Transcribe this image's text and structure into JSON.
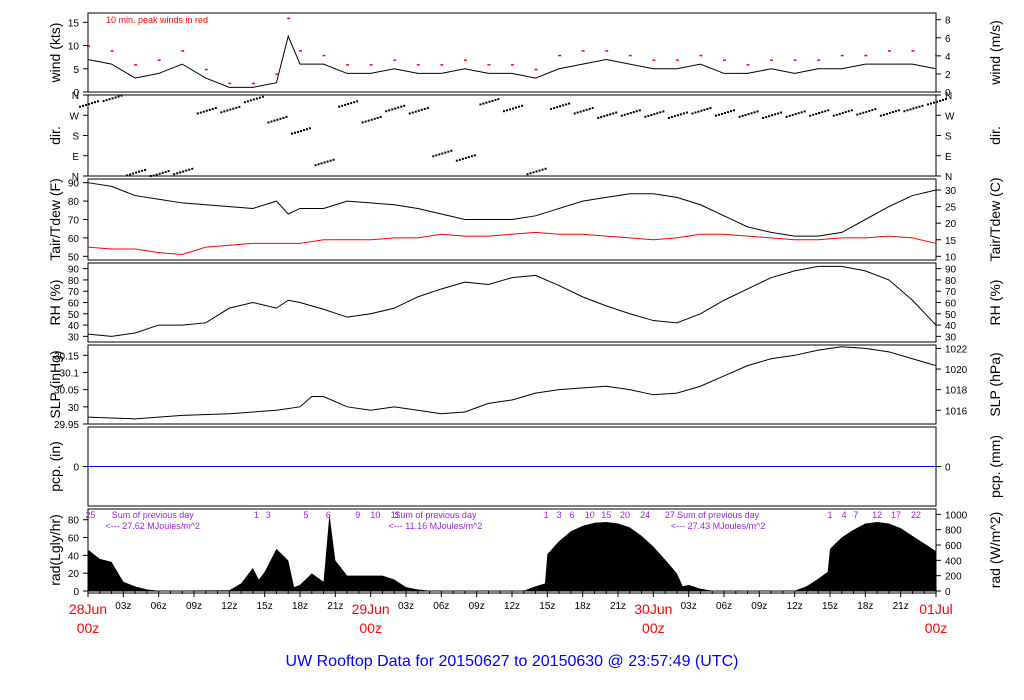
{
  "title": "UW Rooftop Data for 20150627  to  20150630 @ 23:57:49  (UTC)",
  "colors": {
    "red": "#ff0000",
    "blue": "#0000ff",
    "purple": "#a020f0",
    "black": "#000000"
  },
  "chart_data": [
    {
      "type": "line",
      "id": "wind",
      "ylabel": "wind (kts)",
      "ylabel_right": "wind (m/s)",
      "ylim": [
        0,
        17
      ],
      "yticks": [
        0,
        5,
        10,
        15
      ],
      "yticks_right": [
        {
          "v": 0,
          "label": "0"
        },
        {
          "v": 3.89,
          "label": "2"
        },
        {
          "v": 7.78,
          "label": "4"
        },
        {
          "v": 11.66,
          "label": "6"
        },
        {
          "v": 15.55,
          "label": "8"
        }
      ],
      "annotation": "10 min. peak winds in red",
      "hours": [
        0,
        2,
        4,
        6,
        8,
        10,
        12,
        14,
        16,
        17,
        18,
        20,
        22,
        24,
        26,
        28,
        30,
        32,
        34,
        36,
        38,
        40,
        42,
        44,
        46,
        48,
        50,
        52,
        54,
        56,
        58,
        60,
        62,
        64,
        66,
        68,
        70,
        72
      ],
      "series": [
        {
          "name": "wind",
          "values": [
            7,
            6,
            3,
            4,
            6,
            3,
            1,
            1,
            2,
            12,
            6,
            6,
            4,
            4,
            5,
            4,
            4,
            5,
            4,
            4,
            3,
            5,
            6,
            7,
            6,
            5,
            5,
            6,
            4,
            4,
            5,
            4,
            5,
            5,
            6,
            6,
            6,
            5
          ]
        },
        {
          "name": "peak",
          "values": [
            10,
            9,
            6,
            7,
            9,
            5,
            2,
            2,
            4,
            16,
            9,
            8,
            6,
            6,
            7,
            6,
            6,
            7,
            6,
            6,
            5,
            8,
            9,
            9,
            8,
            7,
            7,
            8,
            7,
            6,
            7,
            7,
            7,
            8,
            8,
            9,
            9,
            8
          ]
        }
      ]
    },
    {
      "type": "scatter",
      "id": "dir",
      "ylabel": "dir.",
      "ylabel_right": "dir.",
      "ylim": [
        0,
        360
      ],
      "yticks": [
        {
          "v": 0,
          "label": "N"
        },
        {
          "v": 90,
          "label": "E"
        },
        {
          "v": 180,
          "label": "S"
        },
        {
          "v": 270,
          "label": "W"
        },
        {
          "v": 360,
          "label": "N"
        }
      ],
      "hours": [
        0,
        2,
        4,
        6,
        8,
        10,
        12,
        14,
        16,
        18,
        20,
        22,
        24,
        26,
        28,
        30,
        32,
        34,
        36,
        38,
        40,
        42,
        44,
        46,
        48,
        50,
        52,
        54,
        56,
        58,
        60,
        62,
        64,
        66,
        68,
        70,
        72
      ],
      "values": [
        320,
        345,
        15,
        10,
        20,
        290,
        295,
        340,
        250,
        200,
        60,
        320,
        250,
        300,
        290,
        100,
        80,
        330,
        300,
        20,
        310,
        290,
        270,
        280,
        275,
        270,
        290,
        280,
        275,
        270,
        275,
        280,
        280,
        285,
        280,
        300,
        330
      ]
    },
    {
      "type": "line",
      "id": "temp",
      "ylabel": "Tair/Tdew (F)",
      "ylabel_right": "Tair/Tdew (C)",
      "ylim": [
        48,
        92
      ],
      "yticks": [
        50,
        60,
        70,
        80,
        90
      ],
      "yticks_right": [
        {
          "v": 50,
          "label": "10"
        },
        {
          "v": 59,
          "label": "15"
        },
        {
          "v": 68,
          "label": "20"
        },
        {
          "v": 77,
          "label": "25"
        },
        {
          "v": 86,
          "label": "30"
        }
      ],
      "hours": [
        0,
        2,
        4,
        6,
        8,
        10,
        12,
        14,
        16,
        17,
        18,
        20,
        22,
        24,
        26,
        28,
        30,
        32,
        34,
        36,
        38,
        40,
        42,
        44,
        46,
        48,
        50,
        52,
        54,
        56,
        58,
        60,
        62,
        64,
        66,
        68,
        70,
        72
      ],
      "series": [
        {
          "name": "Tair",
          "values": [
            90,
            88,
            83,
            81,
            79,
            78,
            77,
            76,
            80,
            73,
            76,
            76,
            80,
            79,
            78,
            76,
            73,
            70,
            70,
            70,
            72,
            76,
            80,
            82,
            84,
            84,
            82,
            78,
            72,
            66,
            63,
            61,
            61,
            63,
            70,
            77,
            83,
            86
          ]
        },
        {
          "name": "Tdew",
          "values": [
            55,
            54,
            54,
            52,
            51,
            55,
            56,
            57,
            57,
            57,
            57,
            59,
            59,
            59,
            60,
            60,
            62,
            61,
            61,
            62,
            63,
            62,
            62,
            61,
            60,
            59,
            60,
            62,
            62,
            61,
            60,
            59,
            59,
            60,
            60,
            61,
            60,
            57
          ]
        }
      ]
    },
    {
      "type": "line",
      "id": "rh",
      "ylabel": "RH (%)",
      "ylabel_right": "RH (%)",
      "ylim": [
        25,
        95
      ],
      "yticks": [
        30,
        40,
        50,
        60,
        70,
        80,
        90
      ],
      "hours": [
        0,
        2,
        4,
        6,
        8,
        10,
        12,
        14,
        16,
        17,
        18,
        20,
        22,
        24,
        26,
        28,
        30,
        32,
        34,
        36,
        38,
        40,
        42,
        44,
        46,
        48,
        50,
        52,
        54,
        56,
        58,
        60,
        62,
        64,
        66,
        68,
        70,
        72
      ],
      "values": [
        32,
        30,
        33,
        40,
        40,
        42,
        55,
        60,
        55,
        62,
        60,
        54,
        47,
        50,
        55,
        65,
        72,
        78,
        76,
        82,
        84,
        75,
        65,
        57,
        50,
        44,
        42,
        50,
        62,
        72,
        82,
        88,
        92,
        92,
        88,
        80,
        62,
        40
      ]
    },
    {
      "type": "line",
      "id": "slp",
      "ylabel": "SLP (inHg)",
      "ylabel_right": "SLP (hPa)",
      "ylim": [
        29.95,
        30.18
      ],
      "yticks": [
        29.95,
        30.0,
        30.05,
        30.1,
        30.15
      ],
      "yticks_right": [
        {
          "v": 29.99,
          "label": "1016"
        },
        {
          "v": 30.05,
          "label": "1018"
        },
        {
          "v": 30.11,
          "label": "1020"
        },
        {
          "v": 30.17,
          "label": "1022"
        }
      ],
      "hours": [
        0,
        4,
        8,
        12,
        16,
        18,
        19,
        20,
        22,
        24,
        26,
        28,
        30,
        32,
        34,
        36,
        38,
        40,
        42,
        44,
        46,
        48,
        50,
        52,
        54,
        56,
        58,
        60,
        62,
        64,
        66,
        68,
        70,
        72
      ],
      "values": [
        29.97,
        29.965,
        29.975,
        29.98,
        29.99,
        30.0,
        30.03,
        30.03,
        30.0,
        29.99,
        30.0,
        29.99,
        29.98,
        29.985,
        30.01,
        30.02,
        30.04,
        30.05,
        30.055,
        30.06,
        30.05,
        30.035,
        30.04,
        30.06,
        30.09,
        30.12,
        30.14,
        30.15,
        30.165,
        30.175,
        30.17,
        30.16,
        30.14,
        30.12
      ]
    },
    {
      "type": "line",
      "id": "pcp",
      "ylabel": "pcp. (in)",
      "ylabel_right": "pcp. (mm)",
      "ylim": [
        -1,
        1
      ],
      "yticks": [
        0
      ],
      "yticks_right": [
        {
          "v": 0,
          "label": "0"
        }
      ],
      "hours": [
        0,
        72
      ],
      "values": [
        0,
        0
      ]
    },
    {
      "type": "area",
      "id": "rad",
      "ylabel": "rad(Lgly/hr)",
      "ylabel_right": "rad (W/m^2)",
      "ylim": [
        0,
        1070
      ],
      "yticks": [
        {
          "v": 0,
          "label": "0"
        },
        {
          "v": 232.6,
          "label": "20"
        },
        {
          "v": 465.2,
          "label": "40"
        },
        {
          "v": 697.8,
          "label": "60"
        },
        {
          "v": 930.4,
          "label": "80"
        }
      ],
      "yticks_right": [
        {
          "v": 0,
          "label": "0"
        },
        {
          "v": 200,
          "label": "200"
        },
        {
          "v": 400,
          "label": "400"
        },
        {
          "v": 600,
          "label": "600"
        },
        {
          "v": 800,
          "label": "800"
        },
        {
          "v": 1000,
          "label": "1000"
        }
      ],
      "hours": [
        0,
        1,
        2,
        3,
        4,
        5,
        6,
        12,
        13,
        14,
        14.5,
        15,
        16,
        17,
        17.5,
        18,
        19,
        20,
        20.5,
        21,
        22,
        23,
        24,
        25,
        26,
        27,
        28,
        29,
        37,
        38,
        38.8,
        39,
        40,
        41,
        42,
        43,
        44,
        45,
        46,
        47,
        48,
        49,
        50,
        50.5,
        51,
        52,
        53,
        60,
        61,
        62,
        62.8,
        63,
        64,
        65,
        66,
        67,
        68,
        69,
        70,
        71,
        72
      ],
      "values": [
        540,
        420,
        380,
        120,
        60,
        20,
        5,
        10,
        100,
        300,
        150,
        250,
        550,
        400,
        50,
        80,
        230,
        120,
        1000,
        400,
        200,
        200,
        200,
        200,
        150,
        50,
        20,
        5,
        5,
        60,
        100,
        480,
        650,
        780,
        850,
        890,
        900,
        880,
        830,
        720,
        580,
        410,
        230,
        60,
        80,
        30,
        5,
        5,
        60,
        160,
        250,
        550,
        700,
        800,
        880,
        900,
        880,
        820,
        720,
        620,
        520
      ],
      "sum_header": "Sum of previous day",
      "sums": [
        {
          "hour": 5.5,
          "text": "<--- 27.62 MJoules/m^2"
        },
        {
          "hour": 29.5,
          "text": "<--- 11.16 MJoules/m^2"
        },
        {
          "hour": 53.5,
          "text": "<--- 27.43 MJoules/m^2"
        }
      ],
      "marks": [
        {
          "hour": 0.2,
          "label": "25"
        },
        {
          "hour": 14.3,
          "label": "1"
        },
        {
          "hour": 15.3,
          "label": "3"
        },
        {
          "hour": 18.5,
          "label": "5"
        },
        {
          "hour": 20.4,
          "label": "6"
        },
        {
          "hour": 22.9,
          "label": "9"
        },
        {
          "hour": 24.4,
          "label": "10"
        },
        {
          "hour": 26.1,
          "label": "11"
        },
        {
          "hour": 38.9,
          "label": "1"
        },
        {
          "hour": 40,
          "label": "3"
        },
        {
          "hour": 41.1,
          "label": "6"
        },
        {
          "hour": 42.6,
          "label": "10"
        },
        {
          "hour": 44,
          "label": "15"
        },
        {
          "hour": 45.6,
          "label": "20"
        },
        {
          "hour": 47.3,
          "label": "24"
        },
        {
          "hour": 49.4,
          "label": "27"
        },
        {
          "hour": 63,
          "label": "1"
        },
        {
          "hour": 64.2,
          "label": "4"
        },
        {
          "hour": 65.2,
          "label": "7"
        },
        {
          "hour": 67,
          "label": "12"
        },
        {
          "hour": 68.6,
          "label": "17"
        },
        {
          "hour": 70.3,
          "label": "22"
        }
      ]
    }
  ],
  "xaxis": {
    "hour_ticks": [
      {
        "h": 3,
        "label": "03z"
      },
      {
        "h": 6,
        "label": "06z"
      },
      {
        "h": 9,
        "label": "09z"
      },
      {
        "h": 12,
        "label": "12z"
      },
      {
        "h": 15,
        "label": "15z"
      },
      {
        "h": 18,
        "label": "18z"
      },
      {
        "h": 21,
        "label": "21z"
      },
      {
        "h": 27,
        "label": "03z"
      },
      {
        "h": 30,
        "label": "06z"
      },
      {
        "h": 33,
        "label": "09z"
      },
      {
        "h": 36,
        "label": "12z"
      },
      {
        "h": 39,
        "label": "15z"
      },
      {
        "h": 42,
        "label": "18z"
      },
      {
        "h": 45,
        "label": "21z"
      },
      {
        "h": 51,
        "label": "03z"
      },
      {
        "h": 54,
        "label": "06z"
      },
      {
        "h": 57,
        "label": "09z"
      },
      {
        "h": 60,
        "label": "12z"
      },
      {
        "h": 63,
        "label": "15z"
      },
      {
        "h": 66,
        "label": "18z"
      },
      {
        "h": 69,
        "label": "21z"
      }
    ],
    "day_ticks": [
      {
        "h": 0,
        "date": "28Jun",
        "time": "00z"
      },
      {
        "h": 24,
        "date": "29Jun",
        "time": "00z"
      },
      {
        "h": 48,
        "date": "30Jun",
        "time": "00z"
      },
      {
        "h": 72,
        "date": "01Jul",
        "time": "00z"
      }
    ]
  }
}
